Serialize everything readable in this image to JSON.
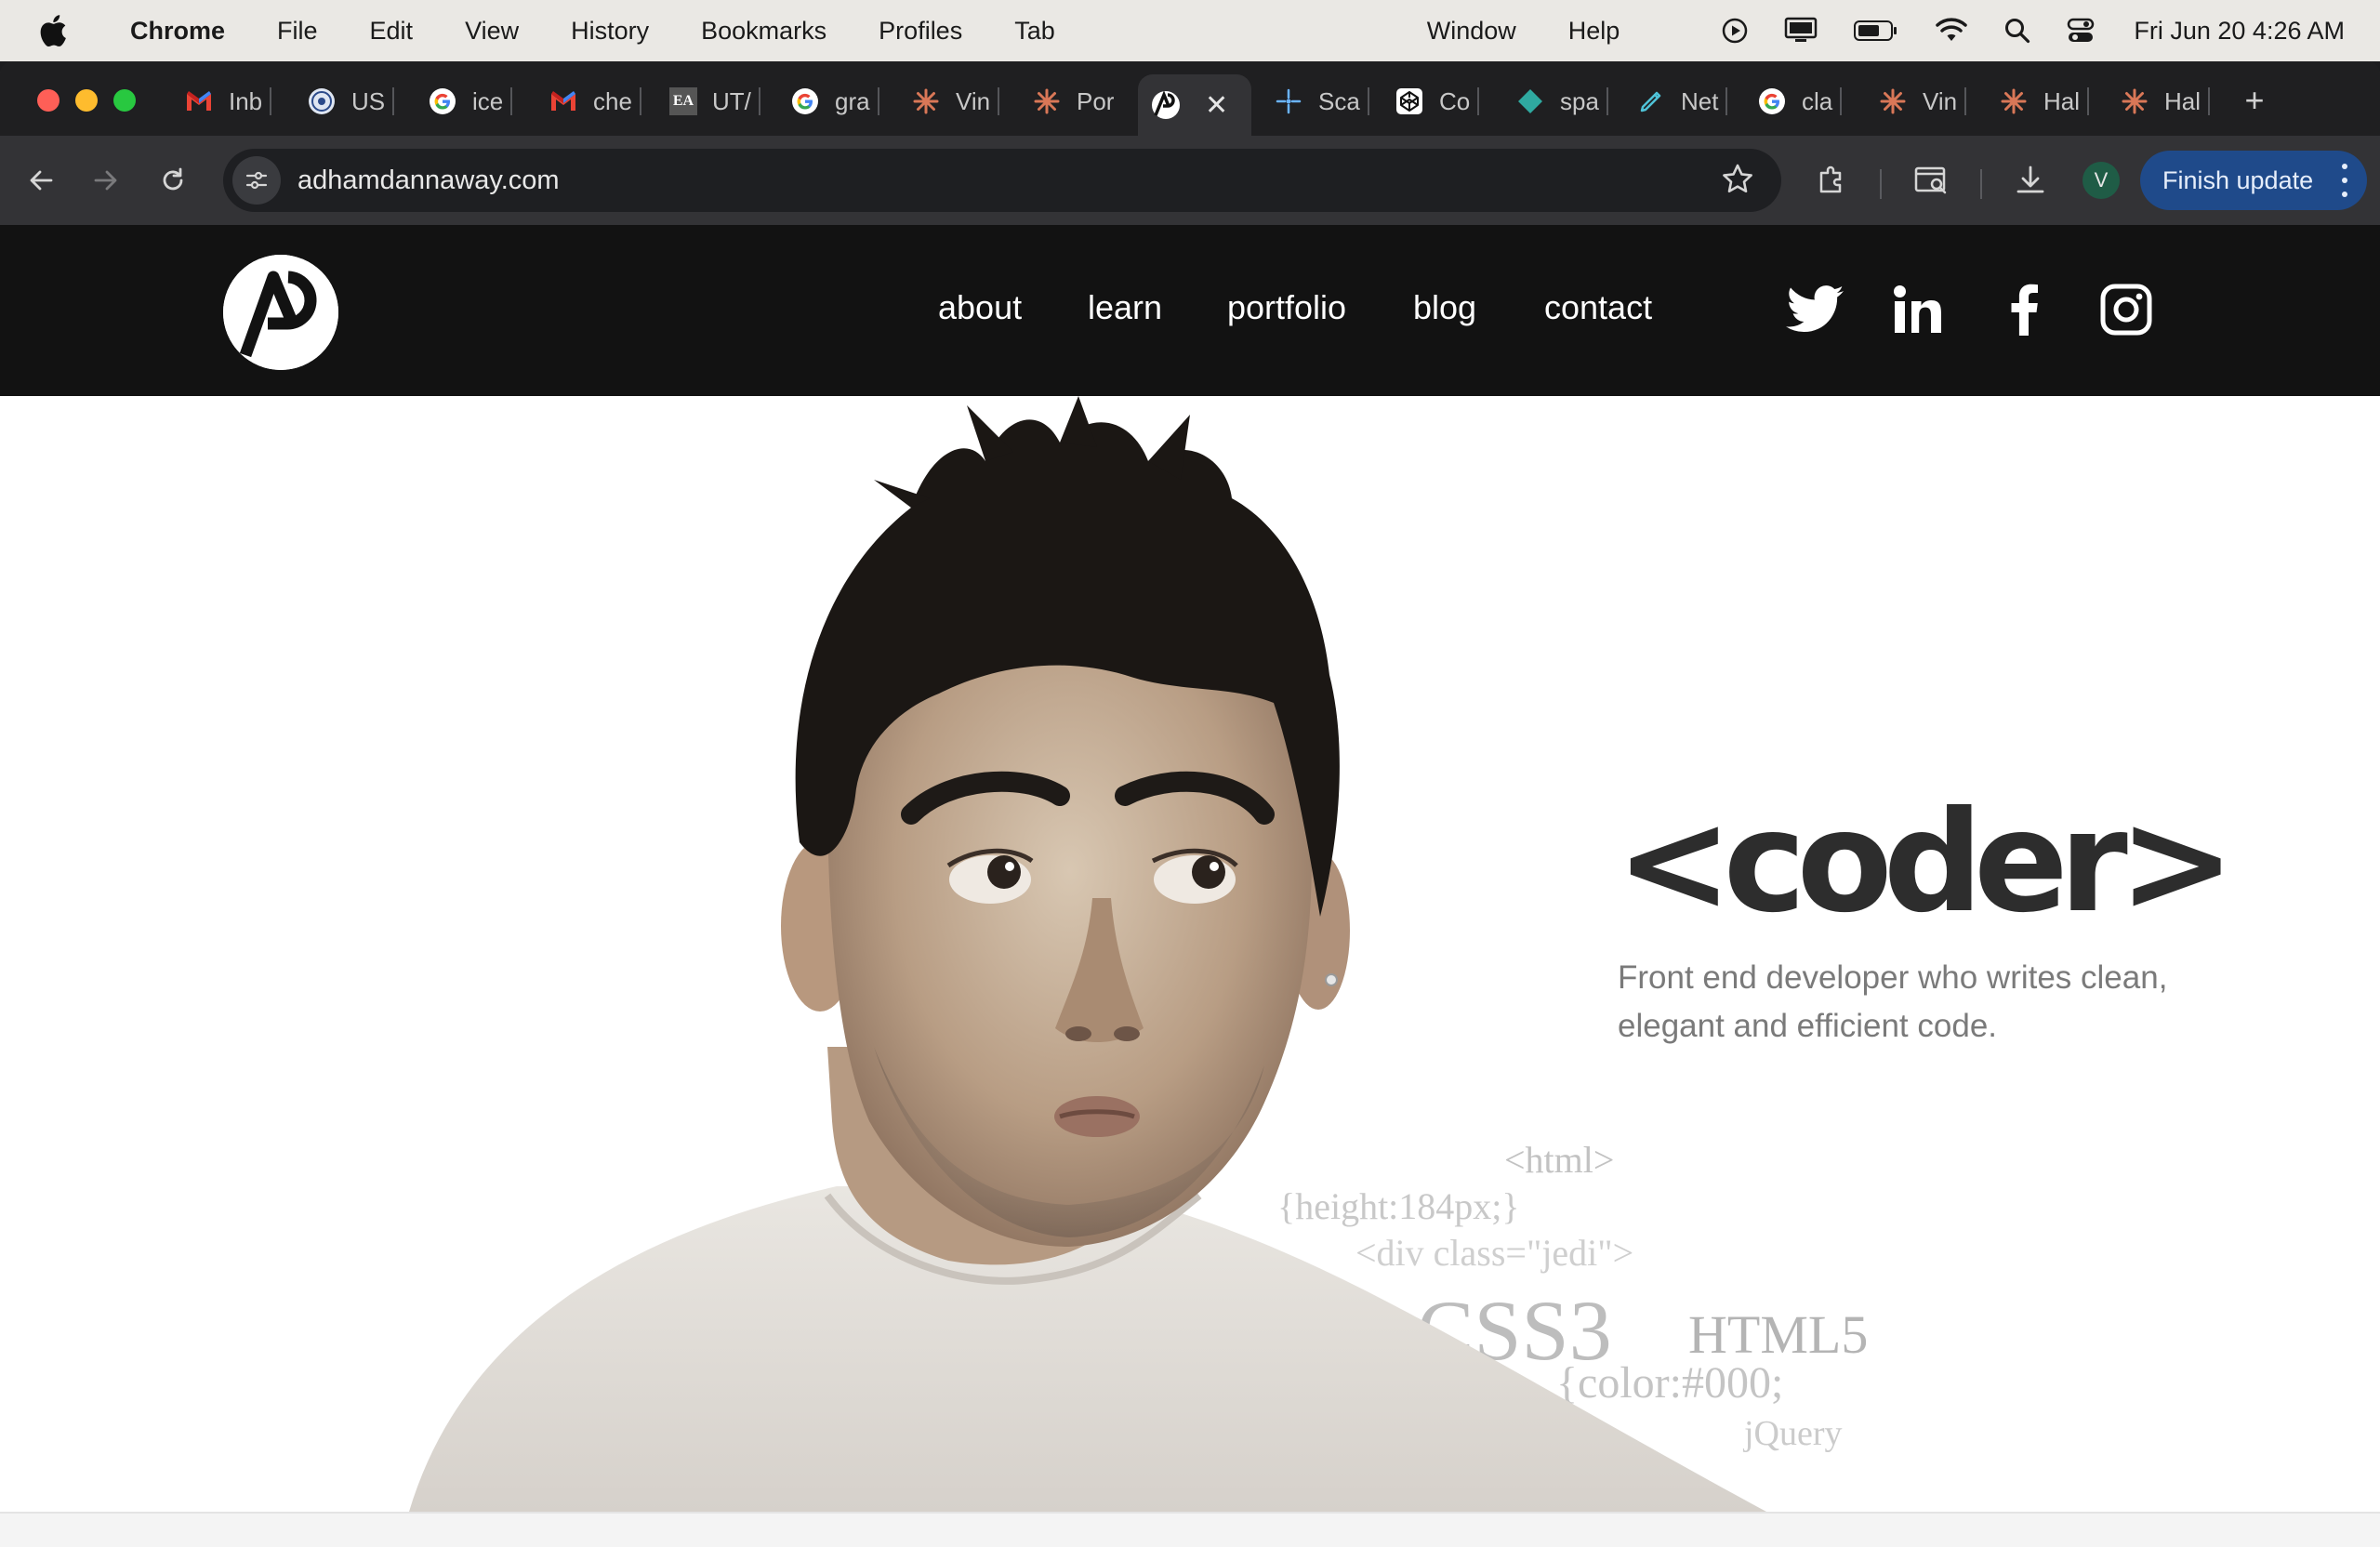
{
  "menubar": {
    "app": "Chrome",
    "items": [
      "File",
      "Edit",
      "View",
      "History",
      "Bookmarks",
      "Profiles",
      "Tab",
      "Window",
      "Help"
    ],
    "clock": "Fri Jun 20  4:26 AM"
  },
  "tabs": [
    {
      "title": "Inb",
      "icon": "gmail-icon"
    },
    {
      "title": "US",
      "icon": "seal-icon"
    },
    {
      "title": "ice",
      "icon": "google-icon"
    },
    {
      "title": "che",
      "icon": "gmail-icon"
    },
    {
      "title": "UT/",
      "icon": "ea-icon"
    },
    {
      "title": "gra",
      "icon": "google-icon"
    },
    {
      "title": "Vin",
      "icon": "claude-icon"
    },
    {
      "title": "Por",
      "icon": "claude-icon"
    },
    {
      "title": "",
      "icon": "ap-logo-icon",
      "active": true
    },
    {
      "title": "Sca",
      "icon": "scale-icon"
    },
    {
      "title": "Co",
      "icon": "codepen-icon"
    },
    {
      "title": "spa",
      "icon": "diamond-icon"
    },
    {
      "title": "Net",
      "icon": "pen-icon"
    },
    {
      "title": "cla",
      "icon": "google-icon"
    },
    {
      "title": "Vin",
      "icon": "claude-icon"
    },
    {
      "title": "Hal",
      "icon": "claude-icon"
    },
    {
      "title": "Hal",
      "icon": "claude-icon"
    }
  ],
  "ea_badge": "EA",
  "profile_initial": "V",
  "omnibox": {
    "url": "adhamdannaway.com"
  },
  "finish_update": "Finish update",
  "site": {
    "nav": [
      "about",
      "learn",
      "portfolio",
      "blog",
      "contact"
    ],
    "social": [
      "twitter-icon",
      "linkedin-icon",
      "facebook-icon",
      "instagram-icon"
    ],
    "hero_title": "<coder>",
    "hero_text": "Front end developer who writes clean, elegant and efficient code.",
    "code_words": [
      "<html>",
      "{height:184px;}",
      "<div class=\"jedi\">",
      "CSS3",
      "HTML5",
      "{color:#000;",
      "jQuery"
    ]
  },
  "colors": {
    "nav_bg": "#121212",
    "accent": "#1f4a8a",
    "title_text": "#2d2d2d",
    "body_text": "#7a7a7a"
  }
}
